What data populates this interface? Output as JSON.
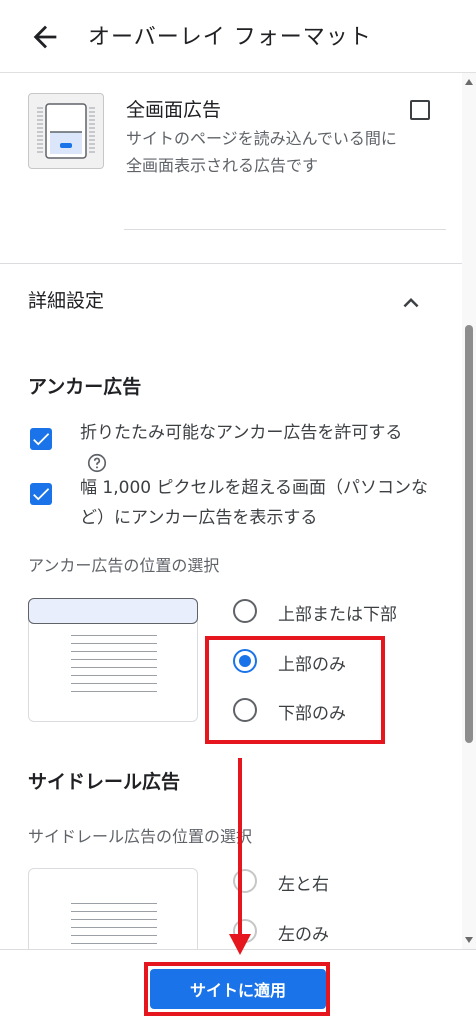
{
  "header": {
    "title": "オーバーレイ フォーマット"
  },
  "fullscreen": {
    "title": "全画面広告",
    "description": "サイトのページを読み込んでいる間に全画面表示される広告です"
  },
  "advanced": {
    "title": "詳細設定"
  },
  "anchor": {
    "heading": "アンカー広告",
    "checkbox1_label": "折りたたみ可能なアンカー広告を許可する",
    "checkbox2_label": "幅 1,000 ピクセルを超える画面（パソコンなど）にアンカー広告を表示する",
    "position_label": "アンカー広告の位置の選択",
    "options": [
      "上部または下部",
      "上部のみ",
      "下部のみ"
    ],
    "selected": "上部のみ"
  },
  "siderail": {
    "heading": "サイドレール広告",
    "position_label": "サイドレール広告の位置の選択",
    "options": [
      "左と右",
      "左のみ"
    ]
  },
  "footer": {
    "apply_label": "サイトに適用"
  },
  "colors": {
    "accent": "#1a73e8",
    "annotation": "#e5161d"
  }
}
